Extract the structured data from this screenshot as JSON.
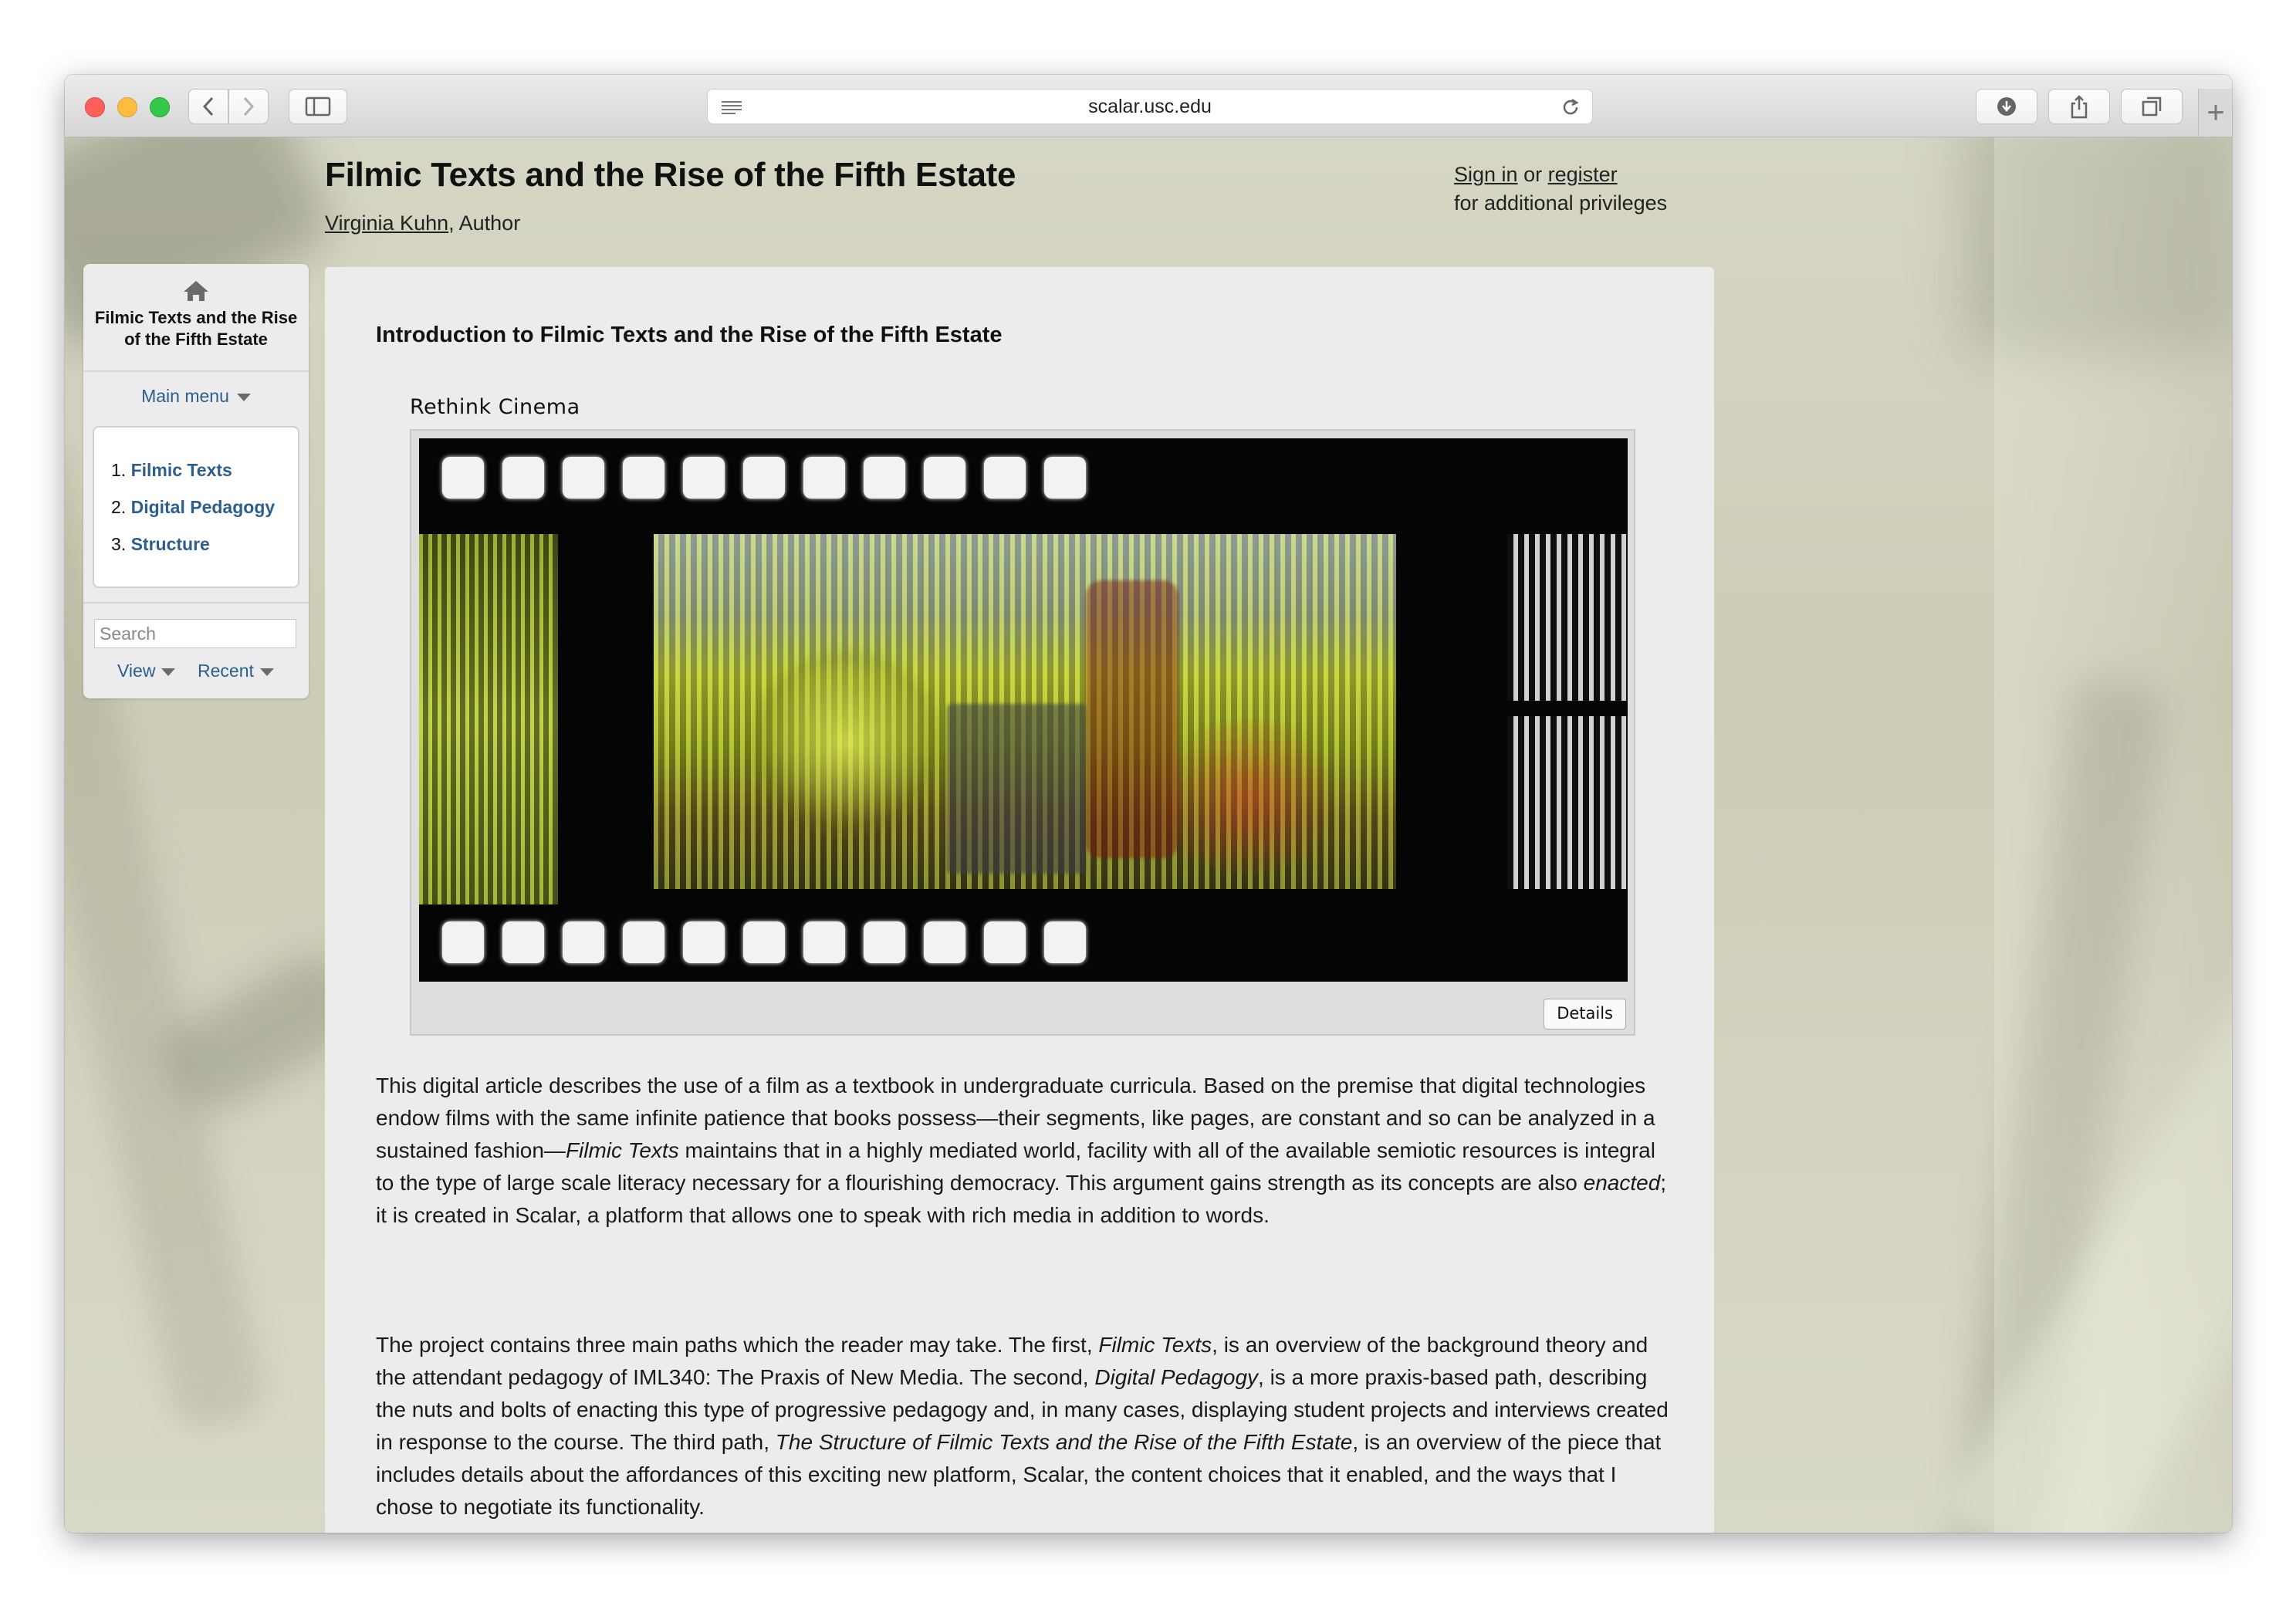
{
  "browser": {
    "url": "scalar.usc.edu"
  },
  "header": {
    "book_title": "Filmic Texts and the Rise of the Fifth Estate",
    "author_name": "Virginia Kuhn",
    "author_role": ", Author",
    "signin_label": "Sign in",
    "or_label": " or ",
    "register_label": "register",
    "privileges_text": "for additional privileges"
  },
  "sidebar": {
    "home_icon": "home-icon",
    "book_title": "Filmic Texts and the Rise of the Fifth Estate",
    "main_menu_label": "Main menu",
    "items": [
      {
        "number": "1.",
        "label": "Filmic Texts"
      },
      {
        "number": "2.",
        "label": "Digital Pedagogy"
      },
      {
        "number": "3.",
        "label": "Structure"
      }
    ],
    "search_placeholder": "Search",
    "view_label": "View",
    "recent_label": "Recent"
  },
  "main": {
    "page_title": "Introduction to Filmic Texts and the Rise of the Fifth Estate",
    "media_title": "Rethink Cinema",
    "details_label": "Details",
    "p1": {
      "a": "This digital article describes the use of a film as a textbook in undergraduate curricula. Based on the premise that digital technologies endow films with the same infinite patience that books possess—their segments, like pages, are constant and so can be analyzed in a sustained fashion—",
      "b": "Filmic Texts",
      "c": " maintains that in a highly mediated world, facility with all of the available semiotic resources is integral to the type of large scale literacy necessary for a flourishing democracy. This argument gains strength as its concepts are also ",
      "d": "enacted",
      "e": "; it is created in Scalar, a platform that allows one to speak with rich media in addition to words."
    },
    "p2": {
      "a": "The project contains three main paths which the reader may take. The first, ",
      "b": "Filmic Texts",
      "c": ", is an overview of the background theory and the attendant pedagogy of IML340: The Praxis of New Media. The second, ",
      "d": "Digital Pedagogy",
      "e": ", is a more praxis-based path, describing the nuts and bolts of enacting this type of progressive pedagogy and, in many cases, displaying student projects and interviews created in response to the course. The third path, ",
      "f": "The Structure of Filmic Texts and the Rise of the Fifth Estate",
      "g": ", is an overview of the piece that includes details about the affordances of this exciting new platform, Scalar, the content choices that it enabled, and the ways that I chose to negotiate its functionality."
    }
  }
}
